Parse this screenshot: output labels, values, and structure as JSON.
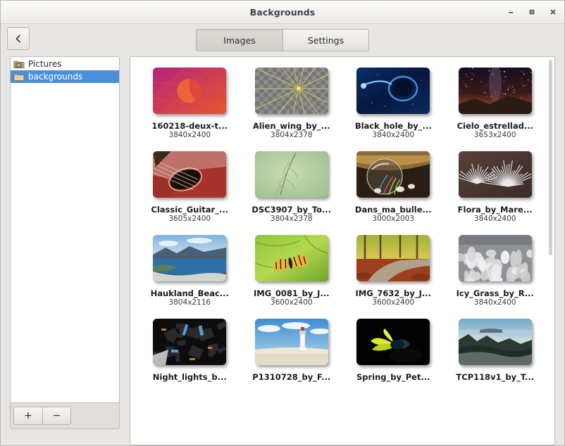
{
  "window": {
    "title": "Backgrounds",
    "controls": [
      {
        "name": "minimize",
        "glyph": "–"
      },
      {
        "name": "maximize",
        "glyph": "■"
      },
      {
        "name": "close",
        "glyph": "✕"
      }
    ]
  },
  "toolbar": {
    "back_label": "‹",
    "tabs": [
      {
        "label": "Images",
        "active": true
      },
      {
        "label": "Settings",
        "active": false
      }
    ]
  },
  "sidebar": {
    "items": [
      {
        "label": "Pictures",
        "icon": "pictures-folder-icon",
        "selected": false
      },
      {
        "label": "backgrounds",
        "icon": "folder-icon",
        "selected": true
      }
    ],
    "add_label": "+",
    "remove_label": "−",
    "selection_color": "#4a90d9"
  },
  "gallery": {
    "items": [
      {
        "name": "160218-deux-t...",
        "dimensions": "3840x2400",
        "thumb": "ubuntu-gradient"
      },
      {
        "name": "Alien_wing_by_...",
        "dimensions": "3804x2378",
        "thumb": "alien-wing"
      },
      {
        "name": "Black_hole_by_...",
        "dimensions": "3840x2400",
        "thumb": "black-hole"
      },
      {
        "name": "Cielo_estrellad...",
        "dimensions": "3653x2400",
        "thumb": "starry-sky"
      },
      {
        "name": "Classic_Guitar_...",
        "dimensions": "3605x2400",
        "thumb": "guitar"
      },
      {
        "name": "DSC3907_by_To...",
        "dimensions": "3804x2378",
        "thumb": "green-plant"
      },
      {
        "name": "Dans_ma_bulle...",
        "dimensions": "3000x2003",
        "thumb": "bubble"
      },
      {
        "name": "Flora_by_Mare...",
        "dimensions": "3840x2400",
        "thumb": "frost-flora"
      },
      {
        "name": "Haukland_Beac...",
        "dimensions": "3804x2116",
        "thumb": "beach"
      },
      {
        "name": "IMG_0081_by_J...",
        "dimensions": "3600x2400",
        "thumb": "butterfly"
      },
      {
        "name": "IMG_7632_by_J...",
        "dimensions": "3600x2400",
        "thumb": "autumn-path"
      },
      {
        "name": "Icy_Grass_by_R...",
        "dimensions": "3840x2400",
        "thumb": "icy-grass"
      },
      {
        "name": "Night_lights_b...",
        "dimensions": "",
        "thumb": "night-lights"
      },
      {
        "name": "P1310728_by_F...",
        "dimensions": "",
        "thumb": "lighthouse"
      },
      {
        "name": "Spring_by_Pet...",
        "dimensions": "",
        "thumb": "spring-flower"
      },
      {
        "name": "TCP118v1_by_T...",
        "dimensions": "",
        "thumb": "misty-forest"
      }
    ]
  }
}
